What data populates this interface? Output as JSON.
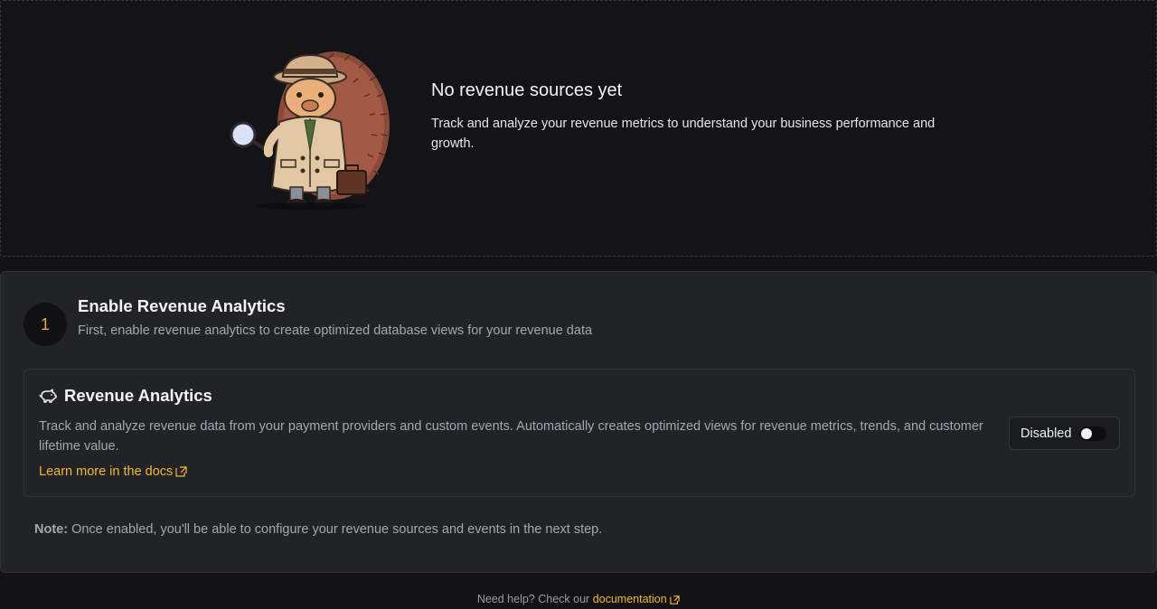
{
  "empty_state": {
    "title": "No revenue sources yet",
    "description": "Track and analyze your revenue metrics to understand your business performance and growth.",
    "illustration_icon": "detective-hedgehog-illustration"
  },
  "setup": {
    "step_number": "1",
    "step_title": "Enable Revenue Analytics",
    "step_description": "First, enable revenue analytics to create optimized database views for your revenue data",
    "feature": {
      "icon": "piggy-bank-icon",
      "title": "Revenue Analytics",
      "description": "Track and analyze revenue data from your payment providers and custom events. Automatically creates optimized views for revenue metrics, trends, and customer lifetime value.",
      "docs_link": "Learn more in the docs",
      "toggle_label": "Disabled",
      "toggle_enabled": false
    },
    "note_label": "Note:",
    "note_text": "Once enabled, you'll be able to configure your revenue sources and events in the next step."
  },
  "footer": {
    "prefix": "Need help? Check our",
    "link": "documentation"
  },
  "colors": {
    "accent": "#f1b83a",
    "background": "#131316",
    "card": "#222327"
  }
}
